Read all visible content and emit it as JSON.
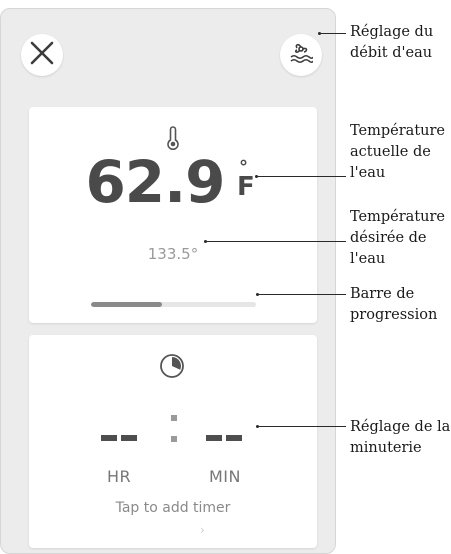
{
  "temperature": {
    "current_value": "62.9",
    "unit_degree": "°",
    "unit": "F",
    "desired": "133.5°"
  },
  "progress": {
    "fraction": 0.43
  },
  "timer": {
    "hours": "--",
    "minutes": "--",
    "hours_label": "HR",
    "minutes_label": "MIN",
    "hint": "Tap to add timer"
  },
  "icons": {
    "close": "close-icon",
    "flow": "water-flow-icon",
    "thermometer": "thermometer-icon",
    "clock": "clock-icon",
    "chevron": "chevron-right-icon"
  },
  "callouts": {
    "flow_rate": "Réglage du\ndébit d'eau",
    "current_temp": "Température\nactuelle de\nl'eau",
    "desired_temp": "Température\ndésirée de\nl'eau",
    "progress_bar": "Barre de\nprogression",
    "timer_setting": "Réglage de la\nminuterie"
  },
  "colors": {
    "background": "#ececec",
    "card": "#ffffff",
    "primary_text": "#4a4a4a",
    "secondary_text": "#9a9a9a",
    "progress_fill": "#8a8a8a",
    "progress_track": "#e6e6e6"
  }
}
